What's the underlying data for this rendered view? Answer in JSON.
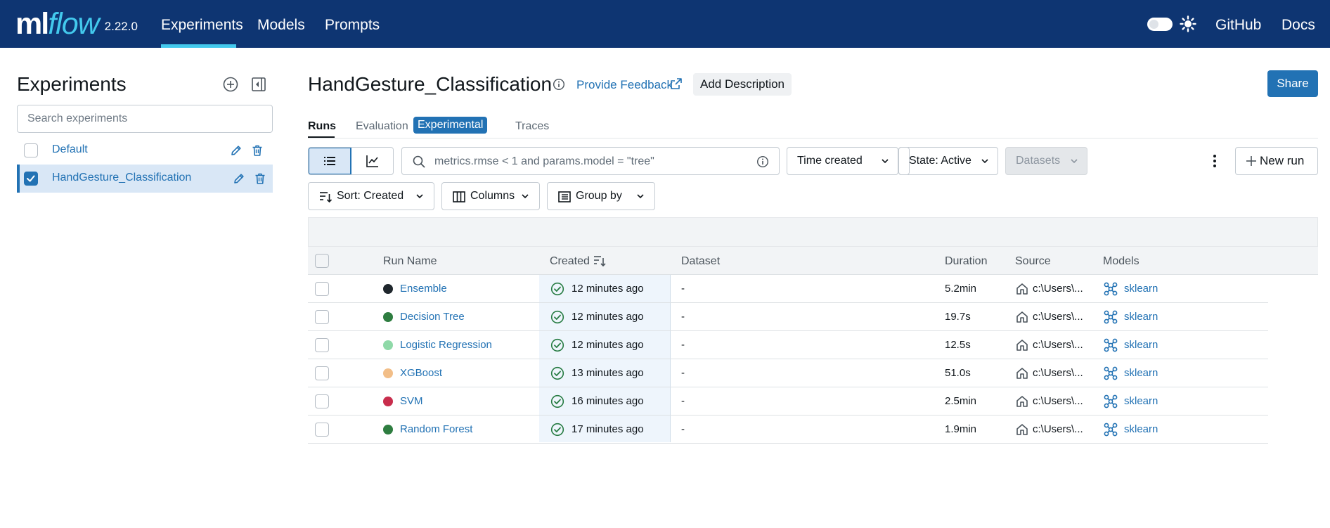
{
  "nav": {
    "logo_ml": "ml",
    "logo_flow": "flow",
    "version": "2.22.0",
    "items": [
      "Experiments",
      "Models",
      "Prompts"
    ],
    "github": "GitHub",
    "docs": "Docs"
  },
  "sidebar": {
    "title": "Experiments",
    "search_placeholder": "Search experiments",
    "experiments": [
      {
        "name": "Default",
        "selected": false
      },
      {
        "name": "HandGesture_Classification",
        "selected": true
      }
    ]
  },
  "header": {
    "title": "HandGesture_Classification",
    "feedback": "Provide Feedback",
    "add_description": "Add Description",
    "share": "Share"
  },
  "tabs": {
    "runs": "Runs",
    "evaluation": "Evaluation",
    "experimental_badge": "Experimental",
    "traces": "Traces"
  },
  "toolbar": {
    "search_query": "metrics.rmse < 1 and params.model = \"tree\"",
    "time_created": "Time created",
    "state": "State: Active",
    "datasets": "Datasets",
    "new_run": "New run",
    "sort": "Sort: Created",
    "columns": "Columns",
    "group_by": "Group by"
  },
  "table": {
    "headers": {
      "run_name": "Run Name",
      "created": "Created",
      "dataset": "Dataset",
      "duration": "Duration",
      "source": "Source",
      "models": "Models"
    },
    "rows": [
      {
        "color": "#1f272d",
        "name": "Ensemble",
        "created": "12 minutes ago",
        "dataset": "-",
        "duration": "5.2min",
        "source": "c:\\Users\\...",
        "model": "sklearn"
      },
      {
        "color": "#2e7d40",
        "name": "Decision Tree",
        "created": "12 minutes ago",
        "dataset": "-",
        "duration": "19.7s",
        "source": "c:\\Users\\...",
        "model": "sklearn"
      },
      {
        "color": "#8fd9a8",
        "name": "Logistic Regression",
        "created": "12 minutes ago",
        "dataset": "-",
        "duration": "12.5s",
        "source": "c:\\Users\\...",
        "model": "sklearn"
      },
      {
        "color": "#f2be88",
        "name": "XGBoost",
        "created": "13 minutes ago",
        "dataset": "-",
        "duration": "51.0s",
        "source": "c:\\Users\\...",
        "model": "sklearn"
      },
      {
        "color": "#c82d4c",
        "name": "SVM",
        "created": "16 minutes ago",
        "dataset": "-",
        "duration": "2.5min",
        "source": "c:\\Users\\...",
        "model": "sklearn"
      },
      {
        "color": "#2e7d40",
        "name": "Random Forest",
        "created": "17 minutes ago",
        "dataset": "-",
        "duration": "1.9min",
        "source": "c:\\Users\\...",
        "model": "sklearn"
      }
    ]
  },
  "colors": {
    "nav_bg": "#0e3572",
    "accent": "#43c9ed",
    "primary": "#2272b4",
    "success": "#277c43"
  }
}
